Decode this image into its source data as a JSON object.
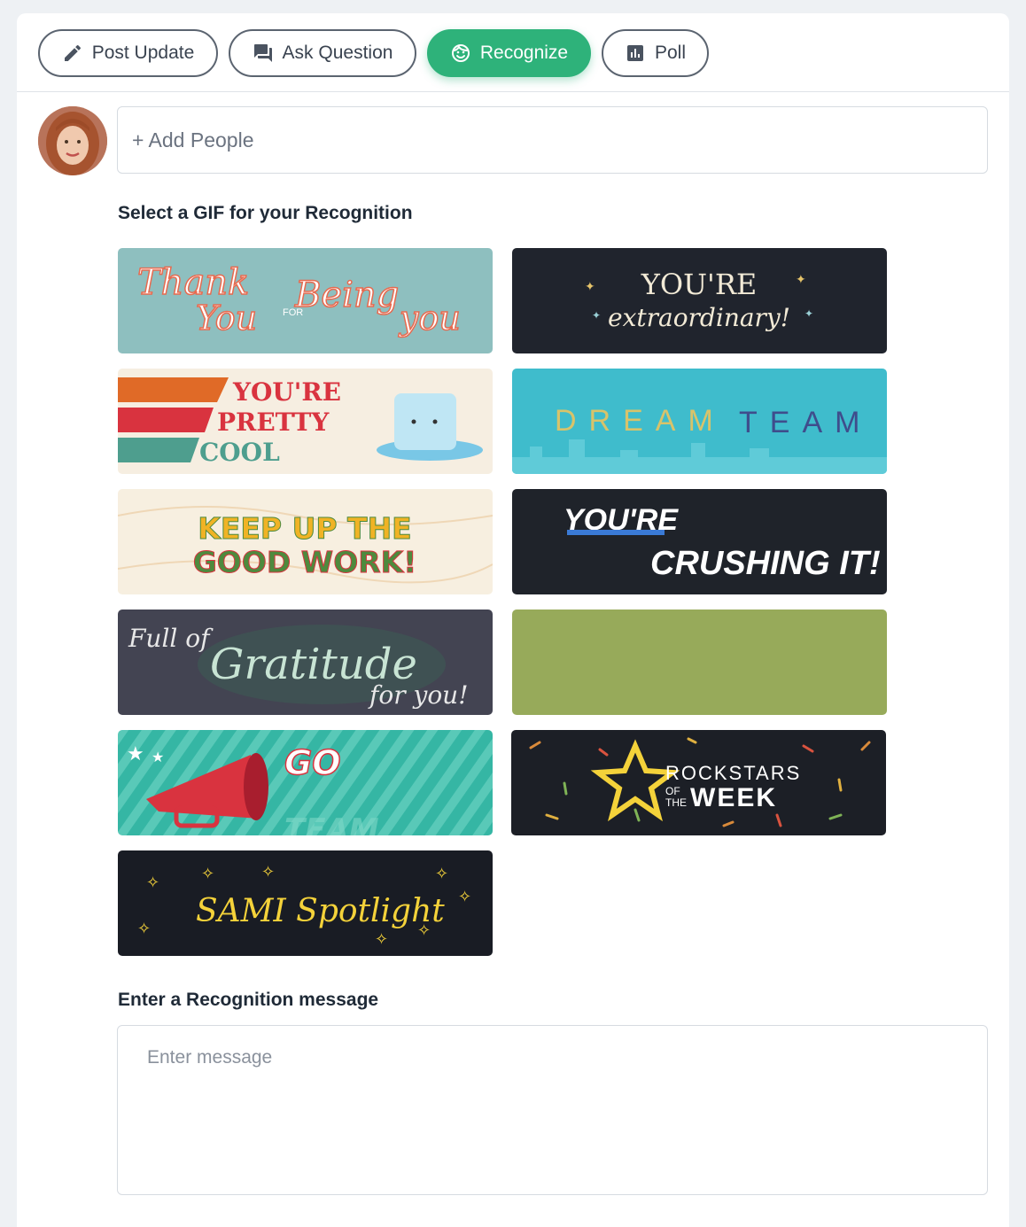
{
  "tabs": [
    {
      "label": "Post Update",
      "icon": "pencil-icon"
    },
    {
      "label": "Ask Question",
      "icon": "chat-icon"
    },
    {
      "label": "Recognize",
      "icon": "smile-icon",
      "active": true
    },
    {
      "label": "Poll",
      "icon": "poll-chart-icon"
    }
  ],
  "colors": {
    "accent": "#2eb27a",
    "border": "#d6dbe1"
  },
  "add_people": {
    "placeholder": "+ Add People"
  },
  "gif_section": {
    "title": "Select a GIF for your Recognition",
    "gifs": [
      {
        "id": "thank-you-for-being-you",
        "lines": [
          "Thank",
          "You",
          "FOR",
          "Being",
          "you"
        ]
      },
      {
        "id": "youre-extraordinary",
        "lines": [
          "YOU'RE",
          "extraordinary!"
        ]
      },
      {
        "id": "youre-pretty-cool",
        "lines": [
          "YOU'RE",
          "PRETTY",
          "COOL"
        ]
      },
      {
        "id": "dream-team",
        "lines": [
          "DREAM",
          "TEAM"
        ]
      },
      {
        "id": "keep-up-the-good-work",
        "lines": [
          "KEEP UP THE",
          "GOOD WORK!"
        ]
      },
      {
        "id": "youre-crushing-it",
        "lines": [
          "YOU'RE",
          "CRUSHING IT!"
        ]
      },
      {
        "id": "full-of-gratitude",
        "lines": [
          "Full of",
          "Gratitude",
          "for you!"
        ]
      },
      {
        "id": "green-blank",
        "lines": []
      },
      {
        "id": "go-team",
        "lines": [
          "GO",
          "TEAM"
        ]
      },
      {
        "id": "rockstars-of-the-week",
        "lines": [
          "ROCKSTARS",
          "OF",
          "THE",
          "WEEK"
        ]
      },
      {
        "id": "sami-spotlight",
        "lines": [
          "SAMI Spotlight"
        ]
      }
    ]
  },
  "message_section": {
    "title": "Enter a Recognition message",
    "placeholder": "Enter message"
  }
}
